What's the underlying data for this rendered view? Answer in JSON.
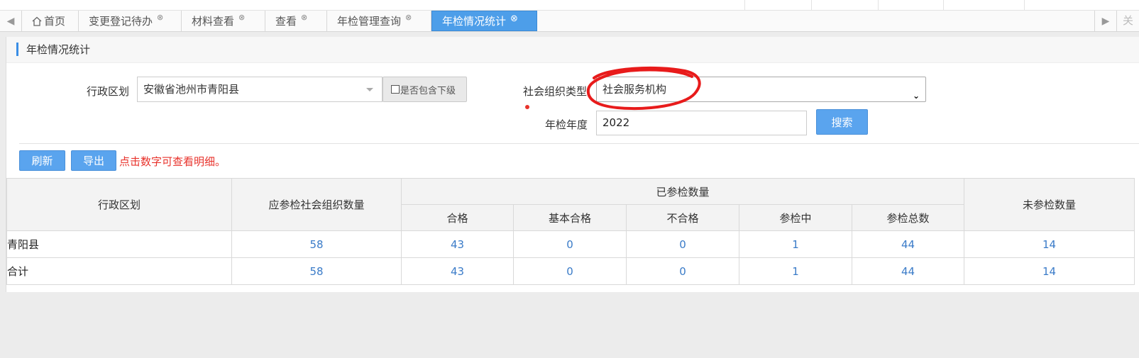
{
  "tabs": [
    {
      "label": "首页",
      "closable": false,
      "active": false
    },
    {
      "label": "变更登记待办",
      "closable": true,
      "active": false
    },
    {
      "label": "材料查看",
      "closable": true,
      "active": false
    },
    {
      "label": "查看",
      "closable": true,
      "active": false
    },
    {
      "label": "年检管理查询",
      "closable": true,
      "active": false
    },
    {
      "label": "年检情况统计",
      "closable": true,
      "active": true
    }
  ],
  "tab_close_all": "关",
  "panel": {
    "title": "年检情况统计"
  },
  "form": {
    "region_label": "行政区划",
    "region_value": "安徽省池州市青阳县",
    "include_sub_label": "是否包含下级",
    "org_type_label": "社会组织类型",
    "org_type_value": "社会服务机构",
    "year_label": "年检年度",
    "year_value": "2022",
    "search_label": "搜索"
  },
  "toolbar": {
    "refresh_label": "刷新",
    "export_label": "导出",
    "hint": "点击数字可查看明细。"
  },
  "table": {
    "headers": {
      "region": "行政区划",
      "should_inspect": "应参检社会组织数量",
      "inspected_group": "已参检数量",
      "not_inspected": "未参检数量",
      "sub": [
        "合格",
        "基本合格",
        "不合格",
        "参检中",
        "参检总数"
      ]
    },
    "rows": [
      {
        "region": "青阳县",
        "should": "58",
        "pass": "43",
        "basic": "0",
        "fail": "0",
        "in_progress": "1",
        "total": "44",
        "not_inspected": "14"
      },
      {
        "region": "合计",
        "should": "58",
        "pass": "43",
        "basic": "0",
        "fail": "0",
        "in_progress": "1",
        "total": "44",
        "not_inspected": "14"
      }
    ]
  },
  "colors": {
    "accent": "#4d9ee9",
    "link": "#3a7bc8",
    "hint": "#e8322b",
    "annotation": "#e81b1b"
  }
}
